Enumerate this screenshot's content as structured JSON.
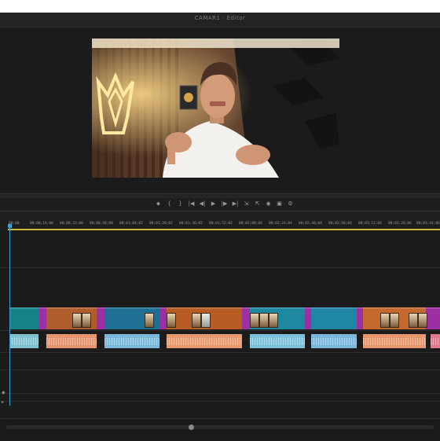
{
  "window": {
    "title": "CAMAR1 · Editor"
  },
  "transport": {
    "icons": [
      "marker-icon",
      "mark-in-icon",
      "mark-out-icon",
      "go-to-in-icon",
      "step-back-icon",
      "play-icon",
      "step-forward-icon",
      "go-to-out-icon",
      "insert-icon",
      "overwrite-icon",
      "export-frame-icon",
      "compare-icon",
      "settings-icon"
    ],
    "glyphs": [
      "⬥",
      "{",
      "}",
      "|◀",
      "◀|",
      "▶",
      "|▶",
      "▶|",
      "⇲",
      "⇱",
      "◉",
      "▣",
      "⚙"
    ]
  },
  "ruler": {
    "labels": [
      "00;00",
      "00;00;16;00",
      "00;00;32;00",
      "00;00;48;00",
      "00;01;04;02",
      "00;01;20;02",
      "00;01;36;02",
      "00;01;52;02",
      "00;02;08;04",
      "00;02;24;04",
      "00;02;40;04",
      "00;02;56;04",
      "00;03;12;04",
      "00;03;28;06",
      "00;03;44;06"
    ]
  },
  "timeline": {
    "video_clip_colors": [
      "#16838a",
      "#b15c2c",
      "#1f6f94",
      "#b85c26",
      "#1d88a0",
      "#c1672a",
      "#1f86a6",
      "#c3692d"
    ],
    "audio_clip_colors": [
      "#7fc1cf",
      "#e6946e",
      "#7ab9d9",
      "#e89a6e",
      "#7cc0dc",
      "#7ab7dc",
      "#e8976c",
      "#e07a8c"
    ],
    "marker_color": "#9b2fa3"
  },
  "side_icons": {
    "v": "◆",
    "a": "▸"
  }
}
